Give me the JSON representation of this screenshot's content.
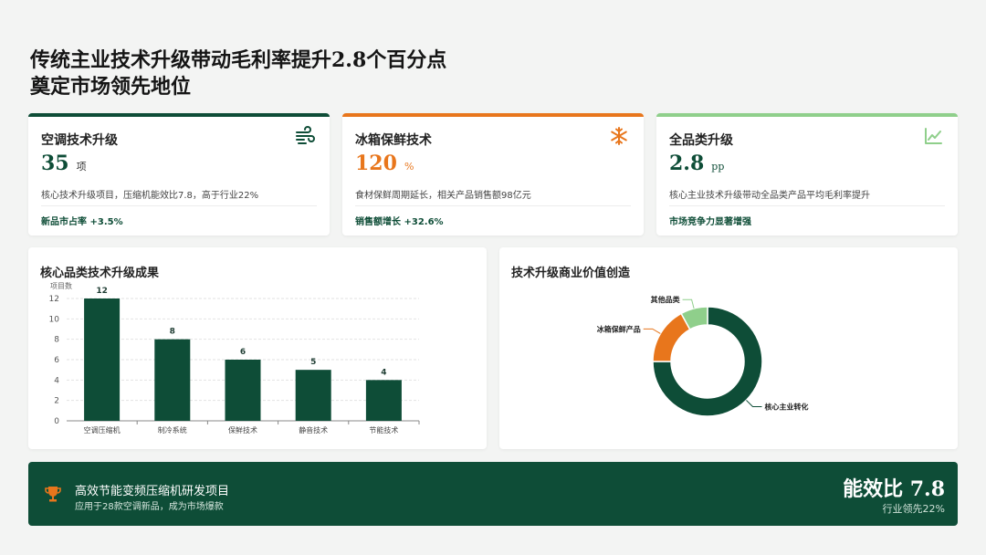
{
  "title": {
    "line1": "传统主业技术升级带动毛利率提升2.8个百分点",
    "line2": "奠定市场领先地位"
  },
  "cards": [
    {
      "name": "空调技术升级",
      "value": "35",
      "unit": "项",
      "desc": "核心技术升级项目，压缩机能效比7.8，高于行业22%",
      "foot": "新品市占率 +3.5%",
      "accent": "#0e4d37",
      "icon": "wind-icon"
    },
    {
      "name": "冰箱保鲜技术",
      "value": "120",
      "unit": "%",
      "desc": "食材保鲜周期延长，相关产品销售额98亿元",
      "foot": "销售额增长 +32.6%",
      "accent": "#e8761c",
      "icon": "snowflake-icon"
    },
    {
      "name": "全品类升级",
      "value": "2.8",
      "unit": "pp",
      "desc": "核心主业技术升级带动全品类产品平均毛利率提升",
      "foot": "市场竞争力显著增强",
      "accent": "#8fcf8b",
      "icon": "line-chart-icon"
    }
  ],
  "bar_panel": {
    "title": "核心品类技术升级成果"
  },
  "pie_panel": {
    "title": "技术升级商业价值创造"
  },
  "chart_data": [
    {
      "type": "bar",
      "title": "核心品类技术升级成果",
      "ylabel": "项目数",
      "categories": [
        "空调压缩机",
        "制冷系统",
        "保鲜技术",
        "静音技术",
        "节能技术"
      ],
      "values": [
        12,
        8,
        6,
        5,
        4
      ],
      "ylim": [
        0,
        12
      ],
      "yticks": [
        0,
        2,
        4,
        6,
        8,
        10,
        12
      ],
      "color": "#0e4d37",
      "grid": true
    },
    {
      "type": "pie",
      "title": "技术升级商业价值创造",
      "donut": true,
      "labels": [
        "核心主业转化",
        "冰箱保鲜产品",
        "其他品类"
      ],
      "values": [
        75,
        17,
        8
      ],
      "colors": [
        "#0e4d37",
        "#e8761c",
        "#8fcf8b"
      ]
    }
  ],
  "bottom": {
    "title": "高效节能变频压缩机研发项目",
    "subtitle": "应用于28款空调新品，成为市场爆款",
    "metric": "能效比 7.8",
    "metric_sub": "行业领先22%",
    "icon": "trophy-icon"
  }
}
